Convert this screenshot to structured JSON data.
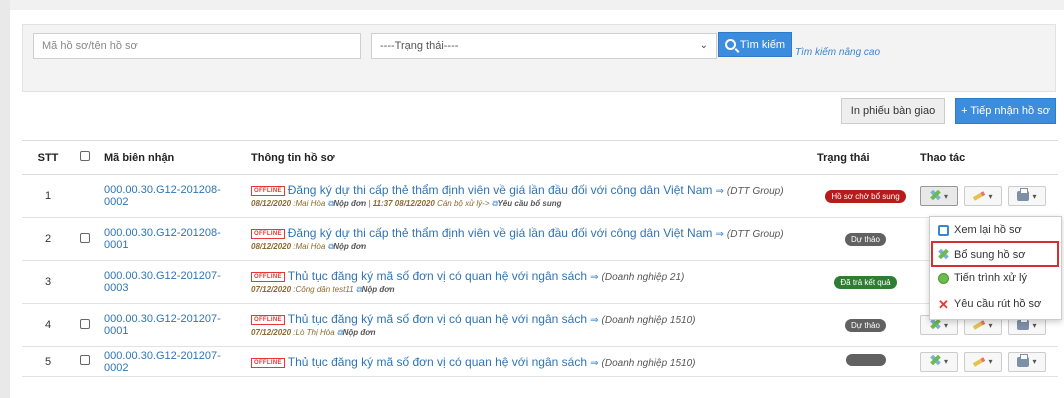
{
  "search": {
    "placeholder": "Mã hồ sơ/tên hồ sơ",
    "status_placeholder": "----Trạng thái----",
    "search_label": "Tìm kiếm",
    "advanced_label": "Tìm kiếm nâng cao"
  },
  "toolbar": {
    "print_label": "In phiếu bàn giao",
    "receive_label": "+ Tiếp nhận hồ sơ"
  },
  "table": {
    "headers": {
      "stt": "STT",
      "code": "Mã biên nhận",
      "info": "Thông tin hồ sơ",
      "status": "Trạng thái",
      "actions": "Thao tác"
    },
    "rows": [
      {
        "stt": "1",
        "code": "000.00.30.G12-201208-0002",
        "tag": "OFFLINE",
        "title": "Đăng ký dự thi cấp thẻ thẩm định viên về giá lần đầu đối với công dân Việt Nam",
        "group": "(DTT Group)",
        "meta_date": "08/12/2020",
        "meta_person": ":Mai Hòa",
        "meta_action": "Nộp đơn",
        "meta_extra_date": "11:37 08/12/2020",
        "meta_extra_text": "Cán bộ xử lý->",
        "meta_extra_action": "Yêu cầu bổ sung",
        "status": "Hồ sơ chờ bổ sung",
        "status_color": "#b71c1c"
      },
      {
        "stt": "2",
        "code": "000.00.30.G12-201208-0001",
        "tag": "OFFLINE",
        "title": "Đăng ký dự thi cấp thẻ thẩm định viên về giá lần đầu đối với công dân Việt Nam",
        "group": "(DTT Group)",
        "meta_date": "08/12/2020",
        "meta_person": ":Mai Hòa",
        "meta_action": "Nộp đơn",
        "status": "Dự thảo",
        "status_color": "#616161"
      },
      {
        "stt": "3",
        "code": "000.00.30.G12-201207-0003",
        "tag": "OFFLINE",
        "title": "Thủ tục đăng ký mã số đơn vị có quan hệ với ngân sách",
        "group": "(Doanh nghiệp 21)",
        "meta_date": "07/12/2020",
        "meta_person": ":Công dân test11",
        "meta_action": "Nộp đơn",
        "status": "Đã trả kết quả",
        "status_color": "#2e7d32"
      },
      {
        "stt": "4",
        "code": "000.00.30.G12-201207-0001",
        "tag": "OFFLINE",
        "title": "Thủ tục đăng ký mã số đơn vị có quan hệ với ngân sách",
        "group": "(Doanh nghiệp 1510)",
        "meta_date": "07/12/2020",
        "meta_person": ":Lò Thị Hòa",
        "meta_action": "Nộp đơn",
        "status": "Dự thảo",
        "status_color": "#616161"
      },
      {
        "stt": "5",
        "code": "000.00.30.G12-201207-0002",
        "tag": "OFFLINE",
        "title": "Thủ tục đăng ký mã số đơn vị có quan hệ với ngân sách",
        "group": "(Doanh nghiệp 1510)",
        "status_color": "#616161"
      }
    ]
  },
  "dropdown": {
    "items": [
      "Xem lại hồ sơ",
      "Bổ sung hồ sơ",
      "Tiến trình xử lý",
      "Yêu cầu rút hồ sơ"
    ]
  }
}
